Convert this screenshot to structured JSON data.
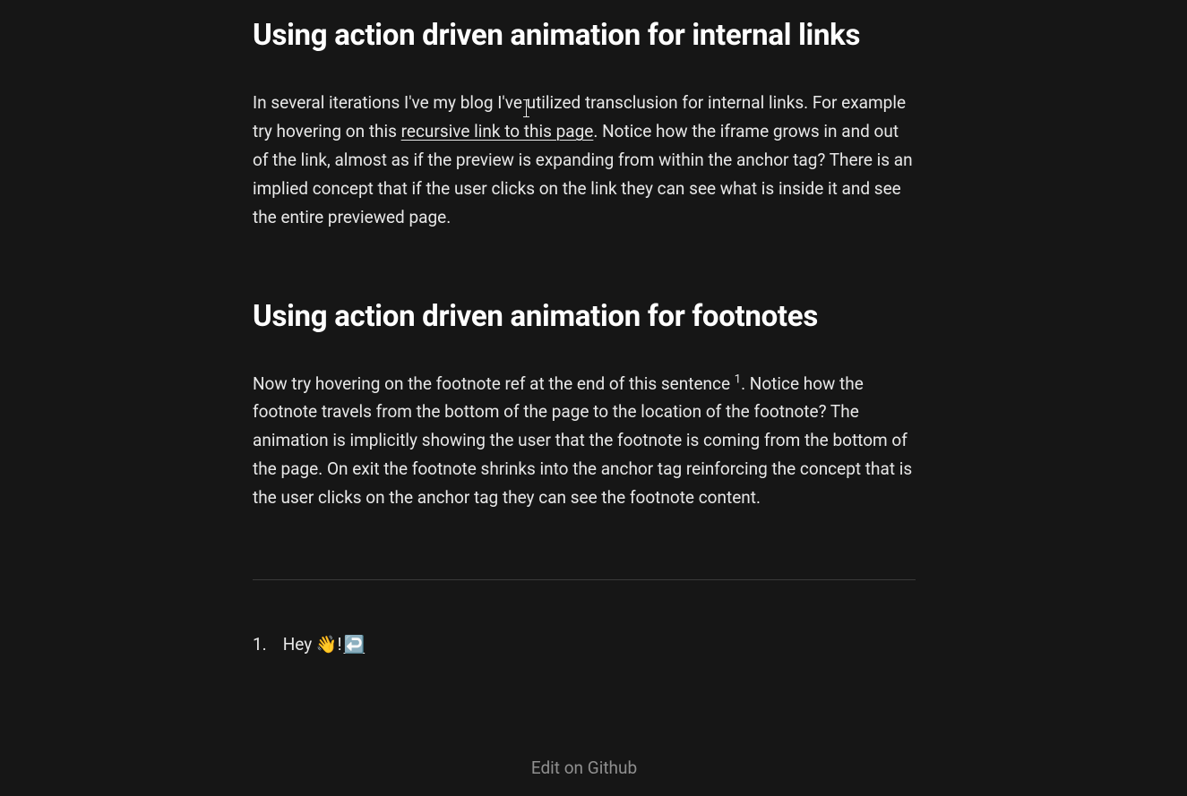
{
  "section1": {
    "heading": "Using action driven animation for internal links",
    "p1a": "In several iterations I've my blog I've utilized transclusion for internal links. For example try hovering on this ",
    "link_text": "recursive link to this page",
    "p1b": ". Notice how the iframe grows in and out of the link, almost as if the preview is expanding from within the anchor tag? There is an implied concept that if the user clicks on the link they can see what is inside it and see the entire previewed page."
  },
  "section2": {
    "heading": "Using action driven animation for footnotes",
    "p1a": "Now try hovering on the footnote ref at the end of this sentence ",
    "footnote_ref": "1",
    "p1b": ". Notice how the footnote travels from the bottom of the page to the location of the footnote? The animation is implicitly showing the user that the footnote is coming from the bottom of the page. On exit the footnote shrinks into the anchor tag reinforcing the concept that is the user clicks on the anchor tag they can see the footnote content."
  },
  "footnotes": {
    "items": [
      {
        "num": "1.",
        "text": "Hey 👋!",
        "back": "↩️"
      }
    ]
  },
  "footer": {
    "edit_link": "Edit on Github"
  }
}
